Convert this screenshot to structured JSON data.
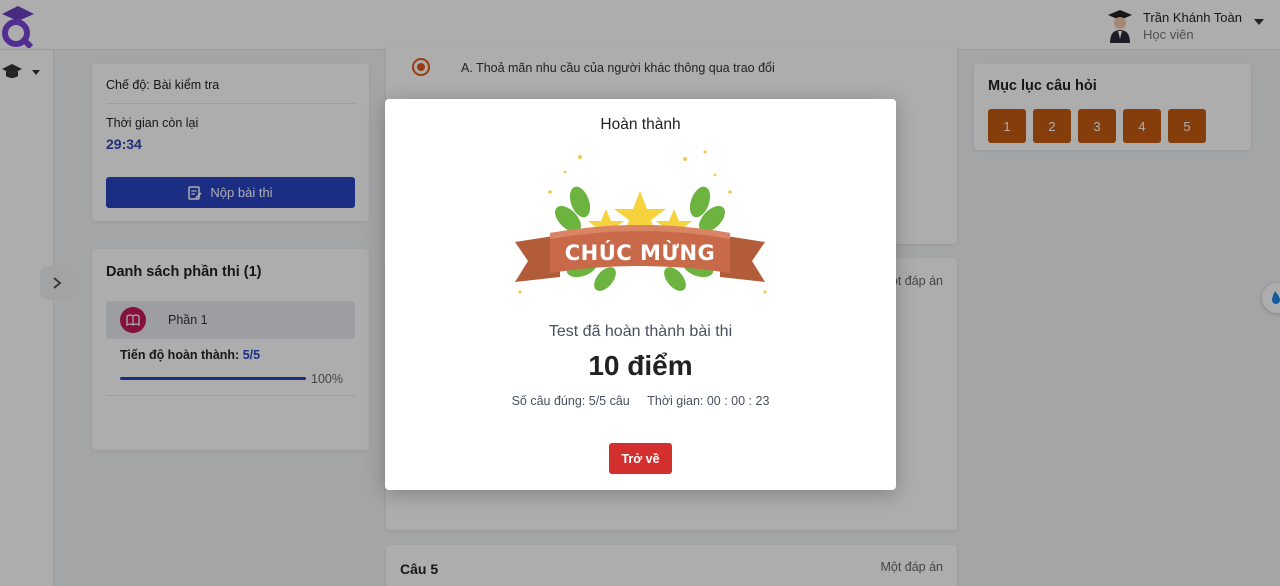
{
  "header": {
    "user_name": "Trần Khánh Toàn",
    "user_role": "Học viên"
  },
  "sidebar": {
    "icon": "graduation-cap-icon"
  },
  "exam": {
    "mode": "Chế độ: Bài kiểm tra",
    "time_label": "Thời gian còn lại",
    "time_value": "29:34",
    "submit_label": "Nộp bài thi"
  },
  "parts": {
    "title": "Danh sách phần thi (1)",
    "items": [
      {
        "label": "Phần 1",
        "progress_label": "Tiến độ hoàn thành:",
        "progress_value": "5/5",
        "percent_text": "100%",
        "percent": 100
      }
    ]
  },
  "questions": {
    "answer_a": "A. Thoả mãn nhu cầu của người khác thông qua trao đổi",
    "q2_type": "Một đáp án",
    "q5_title": "Câu 5",
    "q5_type": "Một đáp án"
  },
  "index": {
    "title": "Mục lục câu hỏi",
    "numbers": [
      "1",
      "2",
      "3",
      "4",
      "5"
    ]
  },
  "modal": {
    "title": "Hoàn thành",
    "banner": "CHÚC MỪNG",
    "subtitle": "Test đã hoàn thành bài thi",
    "score": "10 điểm",
    "correct": "Số câu đúng: 5/5 câu",
    "time": "Thời gian: 00 : 00 : 23",
    "back_label": "Trở về"
  },
  "colors": {
    "primary": "#2a45c3",
    "question_index": "#c55a11",
    "back_button": "#d32f2f",
    "radio": "#e05a1b"
  }
}
